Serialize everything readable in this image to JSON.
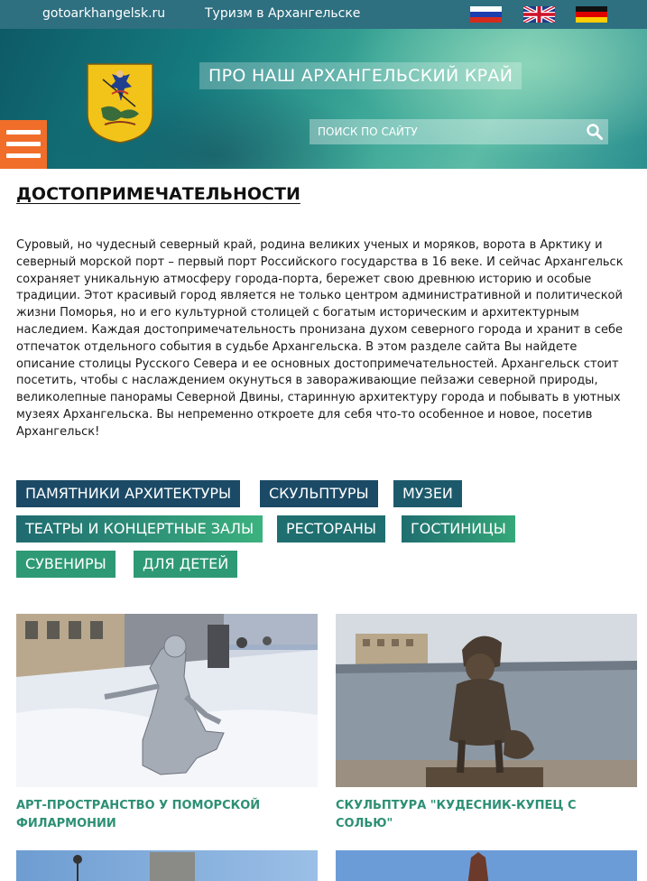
{
  "topbar": {
    "site_link": "gotoarkhangelsk.ru",
    "tourism_link": "Туризм в Архангельске",
    "languages": [
      "ru",
      "en",
      "de"
    ]
  },
  "header": {
    "title": "ПРО НАШ АРХАНГЕЛЬСКИЙ КРАЙ",
    "search_placeholder": "ПОИСК ПО САЙТУ"
  },
  "page": {
    "title": "ДОСТОПРИМЕЧАТЕЛЬНОСТИ",
    "intro": "Суровый, но чудесный северный край, родина великих ученых и моряков, ворота в Арктику и северный морской порт – первый порт Российского государства в 16 веке. И сейчас Архангельск сохраняет уникальную атмосферу города-порта, бережет свою древнюю историю и особые традиции. Этот красивый город является не только центром административной и политической жизни Поморья, но и его культурной столицей с богатым историческим и архитектурным наследием. Каждая достопримечательность пронизана духом северного города и хранит в себе отпечаток отдельного события в судьбе Архангельска. В этом разделе сайта Вы найдете описание столицы Русского Севера и ее основных достопримечательностей. Архангельск стоит посетить, чтобы с наслаждением окунуться в завораживающие пейзажи северной природы, великолепные панорамы Северной Двины, старинную архитектуру города и побывать в уютных музеях Архангельска. Вы непременно откроете для себя что-то особенное и новое, посетив Архангельск!"
  },
  "categories": [
    "ПАМЯТНИКИ АРХИТЕКТУРЫ",
    "СКУЛЬПТУРЫ",
    "МУЗЕИ",
    "ТЕАТРЫ И КОНЦЕРТНЫЕ ЗАЛЫ",
    "РЕСТОРАНЫ",
    "ГОСТИНИЦЫ",
    "СУВЕНИРЫ",
    "ДЛЯ ДЕТЕЙ"
  ],
  "cards": [
    {
      "title": "АРТ-ПРОСТРАНСТВО У ПОМОРСКОЙ ФИЛАРМОНИИ"
    },
    {
      "title": "СКУЛЬПТУРА \"КУДЕСНИК-КУПЕЦ С СОЛЬЮ\""
    }
  ],
  "colors": {
    "topbar": "#2e6f80",
    "burger": "#f06e2a",
    "card_title": "#2d8f74",
    "tag_dark": "#1b4a66",
    "tag_mid": "#1f6e70",
    "tag_green": "#2e9a75",
    "tag_light": "#3bb27e"
  },
  "icons": {
    "menu": "hamburger-icon",
    "search": "magnifier-icon",
    "coat_of_arms": "coat-of-arms"
  }
}
